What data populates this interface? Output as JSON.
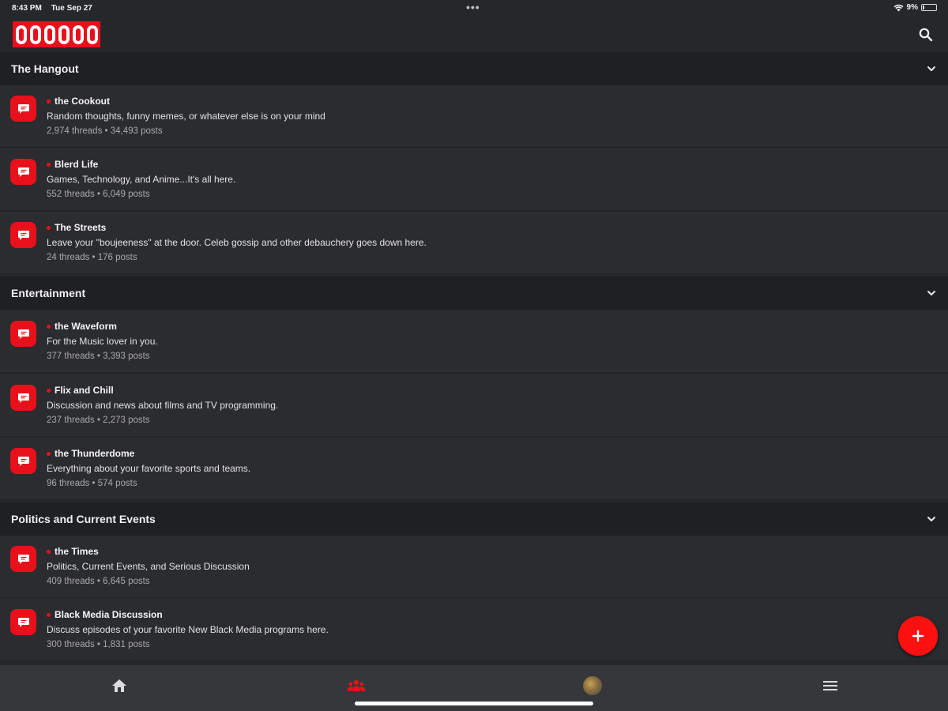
{
  "status_bar": {
    "time": "8:43 PM",
    "date": "Tue Sep 27",
    "battery": "9%"
  },
  "header": {
    "logo_text": "000000"
  },
  "sections": [
    {
      "title": "The Hangout",
      "forums": [
        {
          "name": "the Cookout",
          "description": "Random thoughts, funny memes, or whatever else is on your mind",
          "stats": "2,974 threads • 34,493 posts"
        },
        {
          "name": "Blerd Life",
          "description": "Games, Technology, and Anime...It's all here.",
          "stats": "552 threads • 6,049 posts"
        },
        {
          "name": "The Streets",
          "description": "Leave your \"boujeeness\" at the door. Celeb gossip and other debauchery goes down here.",
          "stats": "24 threads • 176 posts"
        }
      ]
    },
    {
      "title": "Entertainment",
      "forums": [
        {
          "name": "the Waveform",
          "description": "For the Music lover in you.",
          "stats": "377 threads • 3,393 posts"
        },
        {
          "name": "Flix and Chill",
          "description": "Discussion and news about films and TV programming.",
          "stats": "237 threads • 2,273 posts"
        },
        {
          "name": "the Thunderdome",
          "description": "Everything about your favorite sports and teams.",
          "stats": "96 threads • 574 posts"
        }
      ]
    },
    {
      "title": "Politics and Current Events",
      "forums": [
        {
          "name": "the Times",
          "description": "Politics, Current Events, and Serious Discussion",
          "stats": "409 threads • 6,645 posts"
        },
        {
          "name": "Black Media Discussion",
          "description": "Discuss episodes of your favorite New Black Media programs here.",
          "stats": "300 threads • 1,831 posts"
        }
      ]
    }
  ],
  "icons": {
    "forum": "chat-bubble-icon",
    "search": "search-icon",
    "section_toggle": "chevron-down-icon",
    "fab": "plus-icon",
    "tabs": [
      "home-icon",
      "community-icon",
      "avatar",
      "menu-icon"
    ]
  },
  "colors": {
    "accent": "#e8101a",
    "background": "#26272b",
    "section_header": "#1f2023",
    "row": "#2b2c30",
    "bottom_bar": "#36373b"
  }
}
